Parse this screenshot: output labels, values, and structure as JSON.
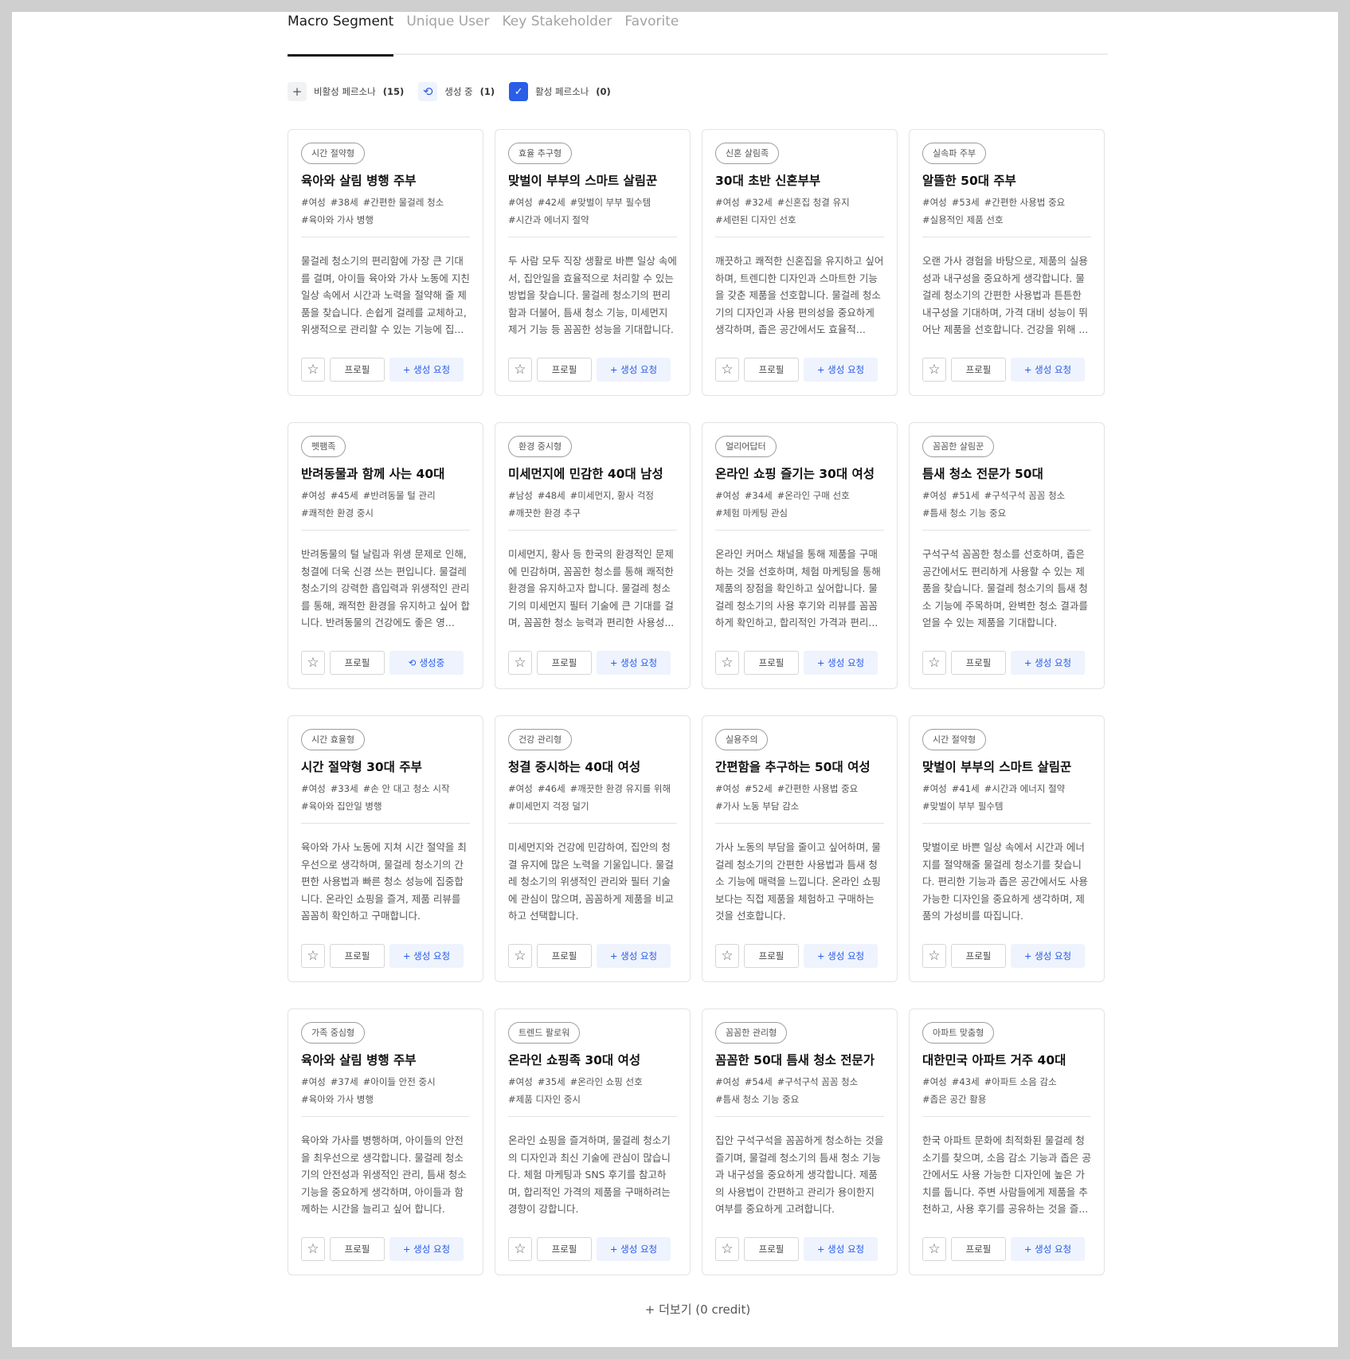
{
  "tabs": [
    {
      "label": "Macro Segment",
      "active": true
    },
    {
      "label": "Unique User",
      "active": false
    },
    {
      "label": "Key Stakeholder",
      "active": false
    },
    {
      "label": "Favorite",
      "active": false
    }
  ],
  "filters": {
    "inactive": {
      "label": "비활성 페르소나",
      "count": "(15)"
    },
    "generating": {
      "label": "생성 중",
      "count": "(1)"
    },
    "active": {
      "label": "활성 페르소나",
      "count": "(0)"
    }
  },
  "buttons": {
    "profile": "프로필",
    "generate": "+ 생성 요청",
    "generating": "생성중"
  },
  "icons": {
    "star": "star-outline-icon",
    "plus": "plus-icon",
    "refresh": "refresh-icon",
    "check": "checkbox-checked-icon"
  },
  "colors": {
    "accent": "#2a5de8",
    "accent_light": "#eef3fe"
  },
  "cards": [
    {
      "tag": "시간 절약형",
      "title": "육아와 살림 병행 주부",
      "tags": [
        "#여성",
        "#38세",
        "#간편한 물걸레 청소",
        "#육아와 가사 병행"
      ],
      "desc": "물걸레 청소기의 편리함에 가장 큰 기대를 걸며, 아이들 육아와 가사 노동에 지친 일상 속에서 시간과 노력을 절약해 줄 제품을 찾습니다. 손쉽게 걸레를 교체하고, 위생적으로 관리할 수 있는 기능에 집...",
      "status": "request"
    },
    {
      "tag": "효율 추구형",
      "title": "맞벌이 부부의 스마트 살림꾼",
      "tags": [
        "#여성",
        "#42세",
        "#맞벌이 부부 필수템",
        "#시간과 에너지 절약"
      ],
      "desc": "두 사람 모두 직장 생활로 바쁜 일상 속에서, 집안일을 효율적으로 처리할 수 있는 방법을 찾습니다. 물걸레 청소기의 편리함과 더불어, 틈새 청소 기능, 미세먼지 제거 기능 등 꼼꼼한 성능을 기대합니다.",
      "status": "request"
    },
    {
      "tag": "신혼 살림족",
      "title": "30대 초반 신혼부부",
      "tags": [
        "#여성",
        "#32세",
        "#신혼집 청결 유지",
        "#세련된 디자인 선호"
      ],
      "desc": "깨끗하고 쾌적한 신혼집을 유지하고 싶어하며, 트렌디한 디자인과 스마트한 기능을 갖춘 제품을 선호합니다. 물걸레 청소기의 디자인과 사용 편의성을 중요하게 생각하며, 좁은 공간에서도 효율적...",
      "status": "request"
    },
    {
      "tag": "실속파 주부",
      "title": "알뜰한 50대 주부",
      "tags": [
        "#여성",
        "#53세",
        "#간편한 사용법 중요",
        "#실용적인 제품 선호"
      ],
      "desc": "오랜 가사 경험을 바탕으로, 제품의 실용성과 내구성을 중요하게 생각합니다. 물걸레 청소기의 간편한 사용법과 튼튼한 내구성을 기대하며, 가격 대비 성능이 뛰어난 제품을 선호합니다. 건강을 위해 ...",
      "status": "request"
    },
    {
      "tag": "펫팸족",
      "title": "반려동물과 함께 사는 40대",
      "tags": [
        "#여성",
        "#45세",
        "#반려동물 털 관리",
        "#쾌적한 환경 중시"
      ],
      "desc": "반려동물의 털 날림과 위생 문제로 인해, 청결에 더욱 신경 쓰는 편입니다. 물걸레 청소기의 강력한 흡입력과 위생적인 관리를 통해, 쾌적한 환경을 유지하고 싶어 합니다. 반려동물의 건강에도 좋은 영...",
      "status": "generating"
    },
    {
      "tag": "환경 중시형",
      "title": "미세먼지에 민감한 40대 남성",
      "tags": [
        "#남성",
        "#48세",
        "#미세먼지, 황사 걱정",
        "#깨끗한 환경 추구"
      ],
      "desc": "미세먼지, 황사 등 한국의 환경적인 문제에 민감하며, 꼼꼼한 청소를 통해 쾌적한 환경을 유지하고자 합니다. 물걸레 청소기의 미세먼지 필터 기술에 큰 기대를 걸며, 꼼꼼한 청소 능력과 편리한 사용성...",
      "status": "request"
    },
    {
      "tag": "얼리어답터",
      "title": "온라인 쇼핑 즐기는 30대 여성",
      "tags": [
        "#여성",
        "#34세",
        "#온라인 구매 선호",
        "#체험 마케팅 관심"
      ],
      "desc": "온라인 커머스 채널을 통해 제품을 구매하는 것을 선호하며, 체험 마케팅을 통해 제품의 장점을 확인하고 싶어합니다. 물걸레 청소기의 사용 후기와 리뷰를 꼼꼼하게 확인하고, 합리적인 가격과 편리...",
      "status": "request"
    },
    {
      "tag": "꼼꼼한 살림꾼",
      "title": "틈새 청소 전문가 50대",
      "tags": [
        "#여성",
        "#51세",
        "#구석구석 꼼꼼 청소",
        "#틈새 청소 기능 중요"
      ],
      "desc": "구석구석 꼼꼼한 청소를 선호하며, 좁은 공간에서도 편리하게 사용할 수 있는 제품을 찾습니다. 물걸레 청소기의 틈새 청소 기능에 주목하며, 완벽한 청소 결과를 얻을 수 있는 제품을 기대합니다.",
      "status": "request"
    },
    {
      "tag": "시간 효율형",
      "title": "시간 절약형 30대 주부",
      "tags": [
        "#여성",
        "#33세",
        "#손 안 대고 청소 시작",
        "#육아와 집안일 병행"
      ],
      "desc": "육아와 가사 노동에 지쳐 시간 절약을 최우선으로 생각하며, 물걸레 청소기의 간편한 사용법과 빠른 청소 성능에 집중합니다. 온라인 쇼핑을 즐겨, 제품 리뷰를 꼼꼼히 확인하고 구매합니다.",
      "status": "request"
    },
    {
      "tag": "건강 관리형",
      "title": "청결 중시하는 40대 여성",
      "tags": [
        "#여성",
        "#46세",
        "#깨끗한 환경 유지를 위해",
        "#미세먼지 걱정 덜기"
      ],
      "desc": "미세먼지와 건강에 민감하여, 집안의 청결 유지에 많은 노력을 기울입니다. 물걸레 청소기의 위생적인 관리와 필터 기술에 관심이 많으며, 꼼꼼하게 제품을 비교하고 선택합니다.",
      "status": "request"
    },
    {
      "tag": "실용주의",
      "title": "간편함을 추구하는 50대 여성",
      "tags": [
        "#여성",
        "#52세",
        "#간편한 사용법 중요",
        "#가사 노동 부담 감소"
      ],
      "desc": "가사 노동의 부담을 줄이고 싶어하며, 물걸레 청소기의 간편한 사용법과 틈새 청소 기능에 매력을 느낍니다. 온라인 쇼핑보다는 직접 제품을 체험하고 구매하는 것을 선호합니다.",
      "status": "request"
    },
    {
      "tag": "시간 절약형",
      "title": "맞벌이 부부의 스마트 살림꾼",
      "tags": [
        "#여성",
        "#41세",
        "#시간과 에너지 절약",
        "#맞벌이 부부 필수템"
      ],
      "desc": "맞벌이로 바쁜 일상 속에서 시간과 에너지를 절약해줄 물걸레 청소기를 찾습니다. 편리한 기능과 좁은 공간에서도 사용 가능한 디자인을 중요하게 생각하며, 제품의 가성비를 따집니다.",
      "status": "request"
    },
    {
      "tag": "가족 중심형",
      "title": "육아와 살림 병행 주부",
      "tags": [
        "#여성",
        "#37세",
        "#아이들 안전 중시",
        "#육아와 가사 병행"
      ],
      "desc": "육아와 가사를 병행하며, 아이들의 안전을 최우선으로 생각합니다. 물걸레 청소기의 안전성과 위생적인 관리, 틈새 청소 기능을 중요하게 생각하며, 아이들과 함께하는 시간을 늘리고 싶어 합니다.",
      "status": "request"
    },
    {
      "tag": "트렌드 팔로워",
      "title": "온라인 쇼핑족 30대 여성",
      "tags": [
        "#여성",
        "#35세",
        "#온라인 쇼핑 선호",
        "#제품 디자인 중시"
      ],
      "desc": "온라인 쇼핑을 즐겨하며, 물걸레 청소기의 디자인과 최신 기술에 관심이 많습니다. 체험 마케팅과 SNS 후기를 참고하며, 합리적인 가격의 제품을 구매하려는 경향이 강합니다.",
      "status": "request"
    },
    {
      "tag": "꼼꼼한 관리형",
      "title": "꼼꼼한 50대 틈새 청소 전문가",
      "tags": [
        "#여성",
        "#54세",
        "#구석구석 꼼꼼 청소",
        "#틈새 청소 기능 중요"
      ],
      "desc": "집안 구석구석을 꼼꼼하게 청소하는 것을 즐기며, 물걸레 청소기의 틈새 청소 기능과 내구성을 중요하게 생각합니다. 제품의 사용법이 간편하고 관리가 용이한지 여부를 중요하게 고려합니다.",
      "status": "request"
    },
    {
      "tag": "아파트 맞춤형",
      "title": "대한민국 아파트 거주 40대",
      "tags": [
        "#여성",
        "#43세",
        "#아파트 소음 감소",
        "#좁은 공간 활용"
      ],
      "desc": "한국 아파트 문화에 최적화된 물걸레 청소기를 찾으며, 소음 감소 기능과 좁은 공간에서도 사용 가능한 디자인에 높은 가치를 둡니다. 주변 사람들에게 제품을 추천하고, 사용 후기를 공유하는 것을 즐...",
      "status": "request"
    }
  ],
  "more": "+ 더보기 (0 credit)"
}
